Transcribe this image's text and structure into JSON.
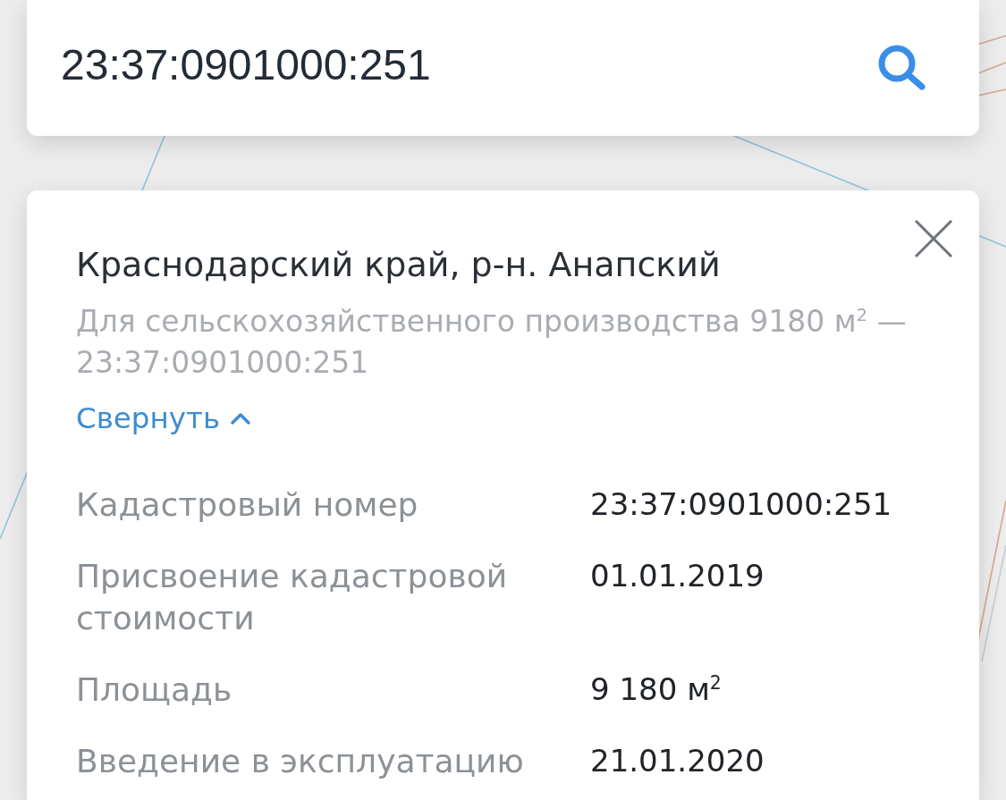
{
  "search": {
    "value": "23:37:0901000:251"
  },
  "card": {
    "title": "Краснодарский край, р-н. Анапский",
    "subtitle": "Для сельскохозяйственного производства 9180 м$^{2}$ — 23:37:0901000:251",
    "toggle": {
      "label": "Свернуть",
      "expanded": true
    },
    "details": [
      {
        "label": "Кадастровый номер",
        "value": "23:37:0901000:251"
      },
      {
        "label": "Присвоение кадастровой стоимости",
        "value": "01.01.2019"
      },
      {
        "label": "Площадь",
        "value": "9 180 м$^{2}$"
      },
      {
        "label": "Введение в эксплуатацию",
        "value": "21.01.2020"
      }
    ]
  }
}
